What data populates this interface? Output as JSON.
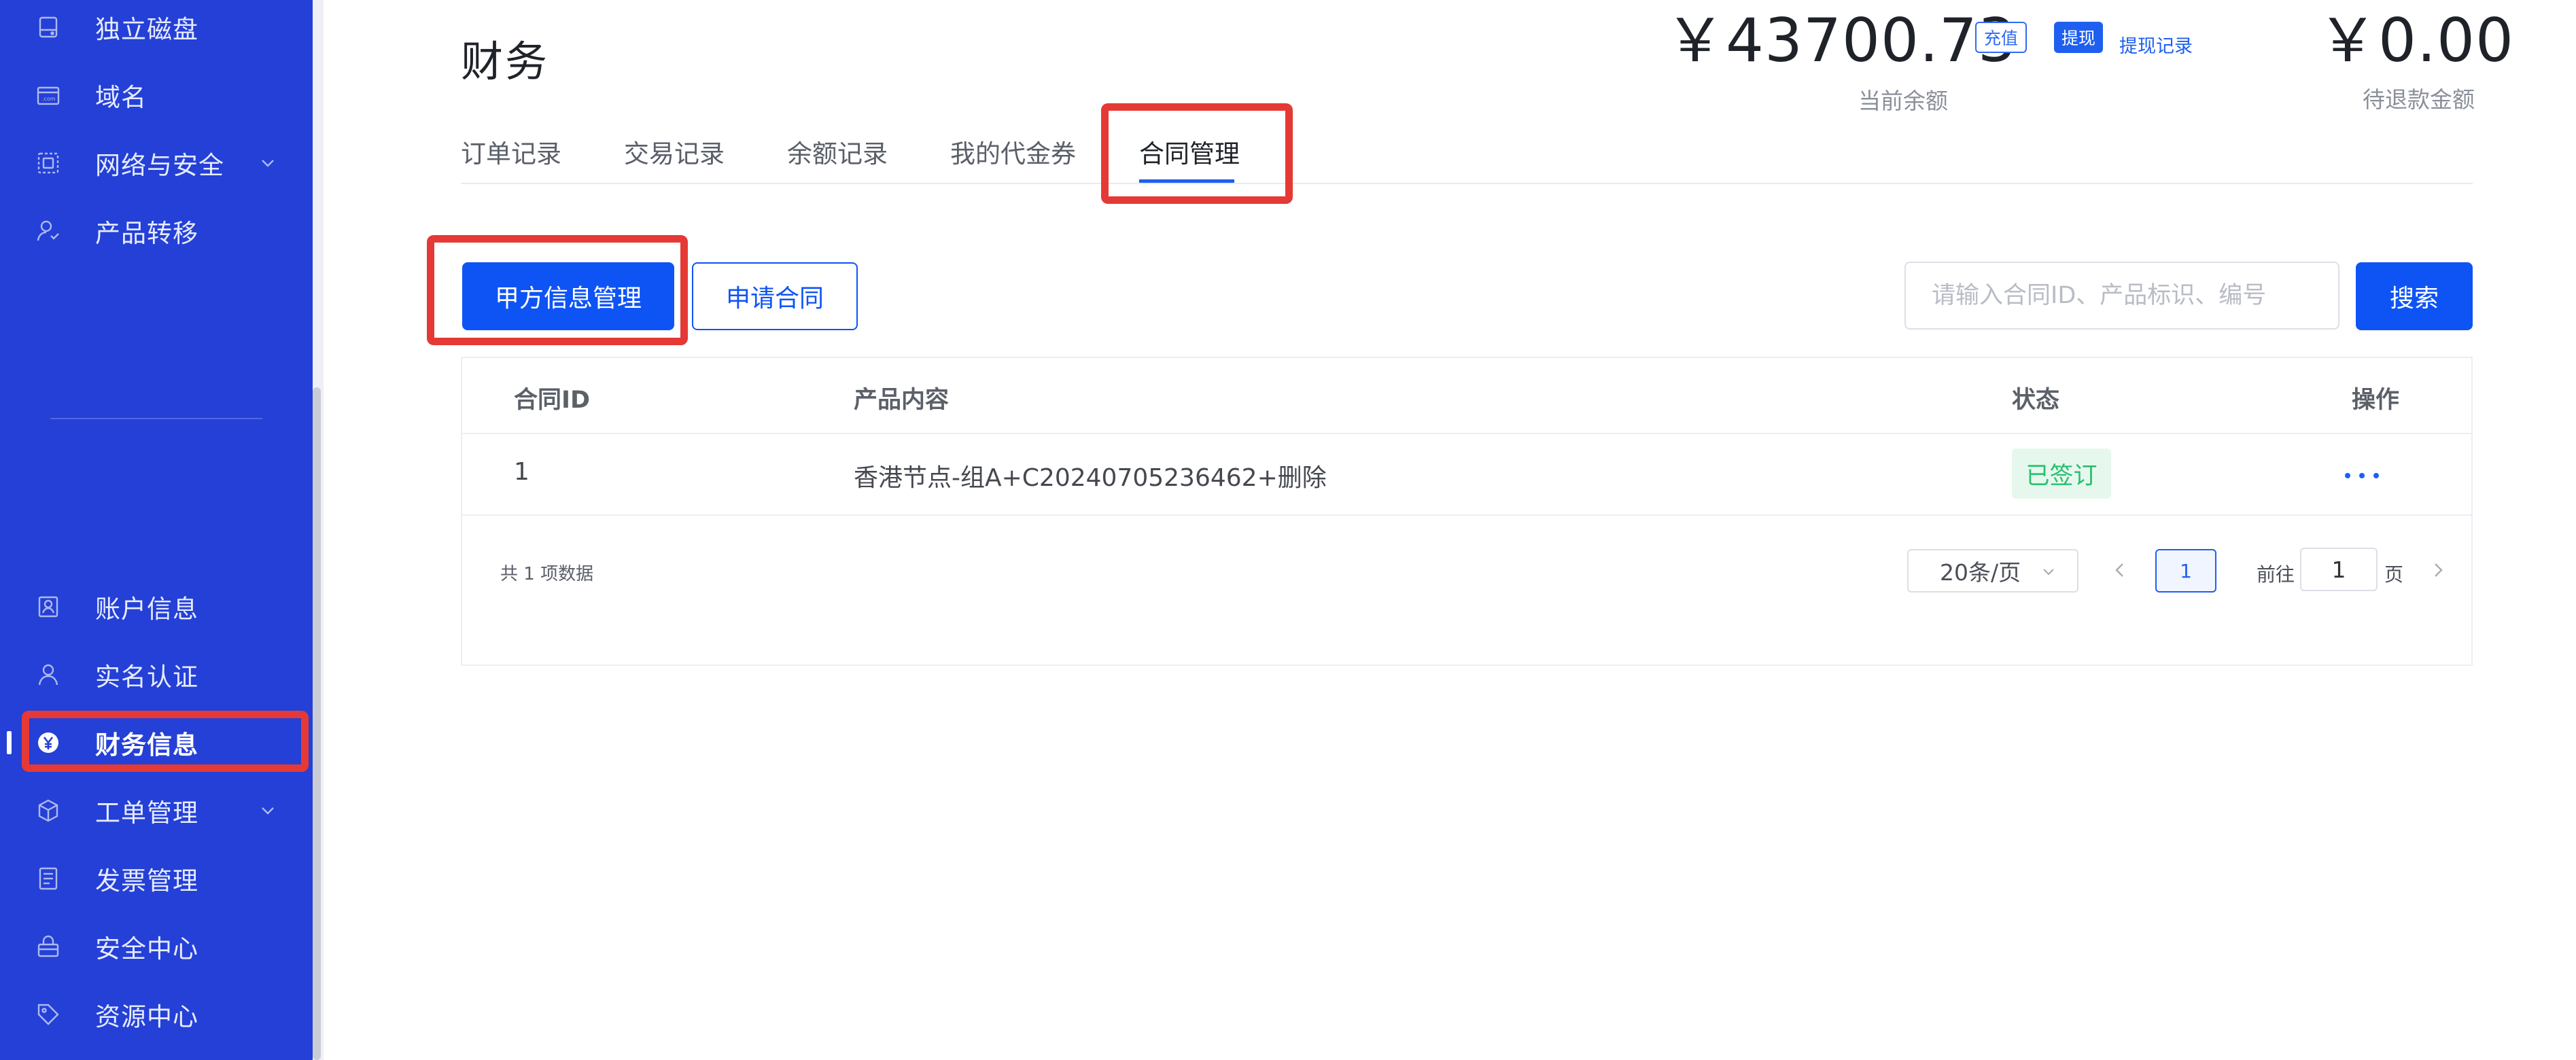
{
  "sidebar": {
    "items": [
      {
        "label": "独立磁盘",
        "icon": "disk-icon"
      },
      {
        "label": "域名",
        "icon": "domain-icon"
      },
      {
        "label": "网络与安全",
        "icon": "network-icon",
        "expandable": true
      },
      {
        "label": "产品转移",
        "icon": "transfer-icon"
      },
      {
        "label": "账户信息",
        "icon": "account-icon"
      },
      {
        "label": "实名认证",
        "icon": "user-icon"
      },
      {
        "label": "财务信息",
        "icon": "yuan-icon",
        "active": true
      },
      {
        "label": "工单管理",
        "icon": "ticket-icon",
        "expandable": true
      },
      {
        "label": "发票管理",
        "icon": "invoice-icon"
      },
      {
        "label": "安全中心",
        "icon": "lock-icon"
      },
      {
        "label": "资源中心",
        "icon": "tag-icon"
      }
    ]
  },
  "header": {
    "title": "财务",
    "balance": {
      "amount": "￥43700.73",
      "caption": "当前余额"
    },
    "recharge_label": "充值",
    "withdraw_label": "提现",
    "withdraw_record_label": "提现记录",
    "refund": {
      "amount": "￥0.00",
      "caption": "待退款金额"
    }
  },
  "tabs": [
    {
      "label": "订单记录"
    },
    {
      "label": "交易记录"
    },
    {
      "label": "余额记录"
    },
    {
      "label": "我的代金券"
    },
    {
      "label": "合同管理",
      "active": true
    }
  ],
  "actions": {
    "party_a_label": "甲方信息管理",
    "apply_label": "申请合同",
    "search_placeholder": "请输入合同ID、产品标识、编号",
    "search_label": "搜索"
  },
  "table": {
    "headers": [
      "合同ID",
      "产品内容",
      "状态",
      "操作"
    ],
    "rows": [
      {
        "id": "1",
        "content": "香港节点-组A+C20240705236462+删除",
        "status": "已签订"
      }
    ]
  },
  "pagination": {
    "total": "共 1 项数据",
    "page_size": "20条/页",
    "current_page": "1",
    "goto_prefix": "前往",
    "goto_value": "1",
    "goto_suffix": "页"
  },
  "colors": {
    "sidebar_bg": "#2440d6",
    "primary": "#0e54f5",
    "highlight": "#e53935",
    "status_green": "#27c06e"
  }
}
